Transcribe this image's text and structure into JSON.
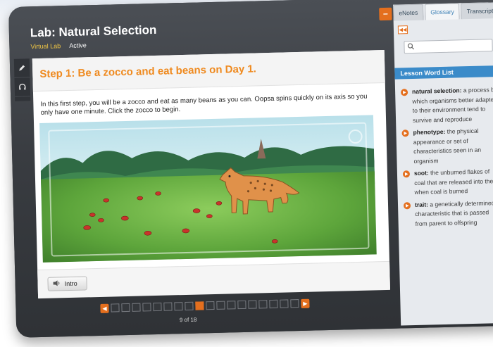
{
  "app": {
    "lab_title": "Lab: Natural Selection",
    "subtitle": "Virtual Lab",
    "status": "Active"
  },
  "tools": [
    {
      "icon": "pencil-icon"
    },
    {
      "icon": "headphones-icon"
    }
  ],
  "step": {
    "title": "Step 1: Be a zocco and eat beans on Day 1.",
    "instructions": "In this first step, you will be a zocco and eat as many beans as you can. Oopsa spins quickly on its axis so you only have one minute. Click the zocco to begin."
  },
  "intro_button": {
    "label": "Intro",
    "icon": "speaker-icon"
  },
  "pager": {
    "label": "9 of 18",
    "total": 18,
    "current": 9
  },
  "side": {
    "tabs": [
      {
        "label": "eNotes"
      },
      {
        "label": "Glossary"
      },
      {
        "label": "Transcript"
      }
    ],
    "search_value": "",
    "word_list_title": "Lesson Word List",
    "words": [
      {
        "term": "natural selection:",
        "definition": " a process by which organisms better adapted to their environment tend to survive and reproduce"
      },
      {
        "term": "phenotype:",
        "definition": " the physical appearance or set of characteristics seen in an organism"
      },
      {
        "term": "soot:",
        "definition": " the unburned flakes of coal that are released into the air when coal is burned"
      },
      {
        "term": "trait:",
        "definition": " a genetically determined characteristic that is passed from parent to offspring"
      }
    ]
  },
  "colors": {
    "accent_orange": "#e46f1e",
    "step_orange": "#ef8a1f",
    "header_blue": "#3b8bc9",
    "subtitle_yellow": "#f2c744"
  }
}
